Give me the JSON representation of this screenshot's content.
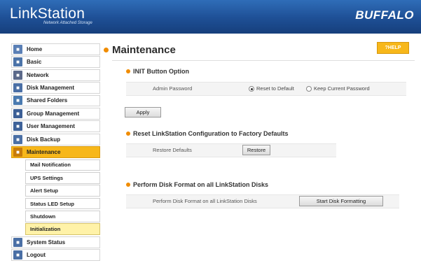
{
  "header": {
    "logo": "LinkStation",
    "logo_sub": "Network Attached Storage",
    "brand": "BUFFALO"
  },
  "sidebar": {
    "items": [
      {
        "label": "Home",
        "icon": "home-icon",
        "color": "#5a7fb5",
        "sub": false,
        "active": false
      },
      {
        "label": "Basic",
        "icon": "basic-icon",
        "color": "#4b73a8",
        "sub": false,
        "active": false
      },
      {
        "label": "Network",
        "icon": "network-icon",
        "color": "#5c6a8a",
        "sub": false,
        "active": false
      },
      {
        "label": "Disk Management",
        "icon": "disk-icon",
        "color": "#4a6fa5",
        "sub": false,
        "active": false
      },
      {
        "label": "Shared Folders",
        "icon": "folder-icon",
        "color": "#4a7ab0",
        "sub": false,
        "active": false
      },
      {
        "label": "Group Management",
        "icon": "group-icon",
        "color": "#3c5f96",
        "sub": false,
        "active": false
      },
      {
        "label": "User Management",
        "icon": "user-icon",
        "color": "#3e6299",
        "sub": false,
        "active": false
      },
      {
        "label": "Disk Backup",
        "icon": "backup-icon",
        "color": "#4a6fa5",
        "sub": false,
        "active": false
      },
      {
        "label": "Maintenance",
        "icon": "wrench-icon",
        "color": "#c77b0a",
        "sub": false,
        "active": true
      },
      {
        "label": "Mail Notification",
        "sub": true,
        "active": false
      },
      {
        "label": "UPS Settings",
        "sub": true,
        "active": false
      },
      {
        "label": "Alert Setup",
        "sub": true,
        "active": false
      },
      {
        "label": "Status LED Setup",
        "sub": true,
        "active": false
      },
      {
        "label": "Shutdown",
        "sub": true,
        "active": false
      },
      {
        "label": "Initialization",
        "sub": true,
        "active": true
      },
      {
        "label": "System Status",
        "icon": "status-icon",
        "color": "#4a6fa5",
        "sub": false,
        "active": false
      },
      {
        "label": "Logout",
        "icon": "logout-icon",
        "color": "#4a6fa5",
        "sub": false,
        "active": false
      }
    ]
  },
  "main": {
    "title": "Maintenance",
    "help_label": "?HELP",
    "init": {
      "title": "INIT Button Option",
      "label": "Admin Password",
      "option1": "Reset to Default",
      "option2": "Keep Current Password",
      "selected": "option1",
      "apply_label": "Apply"
    },
    "reset": {
      "title": "Reset LinkStation Configuration to Factory Defaults",
      "label": "Restore Defaults",
      "button": "Restore"
    },
    "format": {
      "title": "Perform Disk Format on all LinkStation Disks",
      "label": "Perform Disk Format on all LinkStation Disks",
      "button": "Start Disk Formatting"
    }
  }
}
